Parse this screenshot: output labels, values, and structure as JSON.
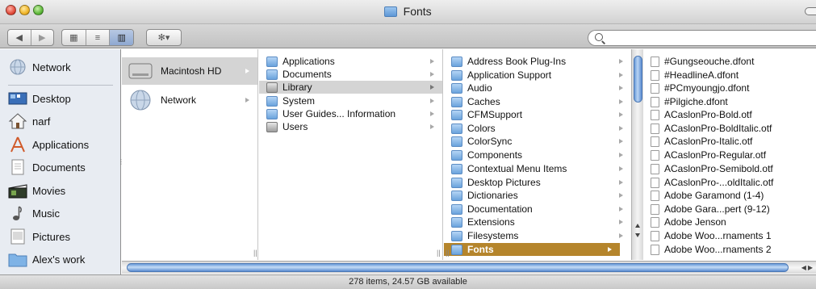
{
  "window": {
    "title": "Fonts"
  },
  "toolbar": {
    "back_label": "◀",
    "forward_label": "▶",
    "view_icon_label": "▦",
    "view_list_label": "≡",
    "view_column_label": "▥",
    "action_label": "✻▾",
    "search": {
      "value": "",
      "placeholder": ""
    }
  },
  "sidebar": {
    "items": [
      {
        "label": "Network",
        "icon": "network-globe-icon"
      },
      {
        "label": "Desktop",
        "icon": "desktop-icon"
      },
      {
        "label": "narf",
        "icon": "home-icon"
      },
      {
        "label": "Applications",
        "icon": "applications-icon"
      },
      {
        "label": "Documents",
        "icon": "documents-icon"
      },
      {
        "label": "Movies",
        "icon": "movies-icon"
      },
      {
        "label": "Music",
        "icon": "music-icon"
      },
      {
        "label": "Pictures",
        "icon": "pictures-icon"
      },
      {
        "label": "Alex's work",
        "icon": "folder-icon"
      }
    ]
  },
  "columns": {
    "col1": [
      {
        "label": "Macintosh HD",
        "selected": true
      },
      {
        "label": "Network",
        "selected": false
      }
    ],
    "col2": [
      {
        "label": "Applications"
      },
      {
        "label": "Documents"
      },
      {
        "label": "Library"
      },
      {
        "label": "System"
      },
      {
        "label": "User Guides... Information"
      },
      {
        "label": "Users"
      }
    ],
    "col3": [
      {
        "label": "Address Book Plug-Ins"
      },
      {
        "label": "Application Support"
      },
      {
        "label": "Audio"
      },
      {
        "label": "Caches"
      },
      {
        "label": "CFMSupport"
      },
      {
        "label": "Colors"
      },
      {
        "label": "ColorSync"
      },
      {
        "label": "Components"
      },
      {
        "label": "Contextual Menu Items"
      },
      {
        "label": "Desktop Pictures"
      },
      {
        "label": "Dictionaries"
      },
      {
        "label": "Documentation"
      },
      {
        "label": "Extensions"
      },
      {
        "label": "Filesystems"
      },
      {
        "label": "Fonts"
      }
    ],
    "col4": [
      {
        "label": "#Gungseouche.dfont"
      },
      {
        "label": "#HeadlineA.dfont"
      },
      {
        "label": "#PCmyoungjo.dfont"
      },
      {
        "label": "#Pilgiche.dfont"
      },
      {
        "label": "ACaslonPro-Bold.otf"
      },
      {
        "label": "ACaslonPro-BoldItalic.otf"
      },
      {
        "label": "ACaslonPro-Italic.otf"
      },
      {
        "label": "ACaslonPro-Regular.otf"
      },
      {
        "label": "ACaslonPro-Semibold.otf"
      },
      {
        "label": "ACaslonPro-...oldItalic.otf"
      },
      {
        "label": "Adobe Garamond (1-4)"
      },
      {
        "label": "Adobe Gara...pert (9-12)"
      },
      {
        "label": "Adobe Jenson"
      },
      {
        "label": "Adobe Woo...rnaments 1"
      },
      {
        "label": "Adobe Woo...rnaments 2"
      }
    ]
  },
  "status": {
    "text": "278 items, 24.57 GB available"
  },
  "colors": {
    "selection_gold": "#b5852c",
    "selection_gray": "#d4d4d4",
    "sidebar_bg": "#e8ecf2"
  }
}
